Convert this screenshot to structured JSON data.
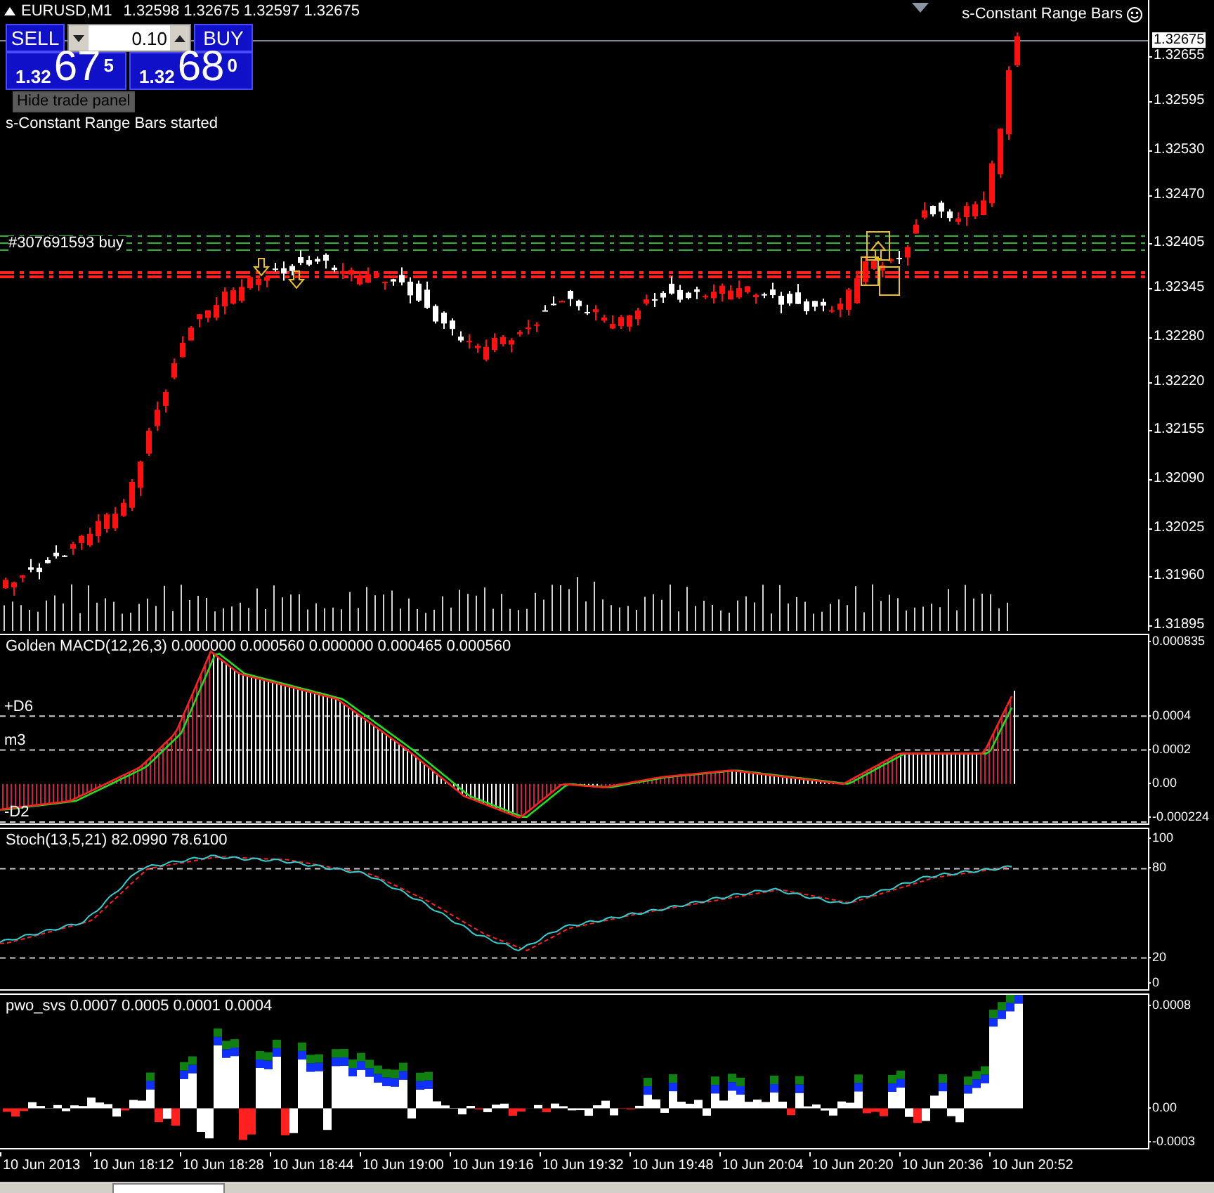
{
  "chart_header": {
    "symbol": "EURUSD,M1",
    "quotes": "1.32598 1.32675 1.32597 1.32675"
  },
  "trade_panel": {
    "sell_label": "SELL",
    "buy_label": "BUY",
    "lot_value": "0.10",
    "tooltip": "Hide trade panel",
    "sell_price": {
      "prefix": "1.32",
      "big": "67",
      "pip": "5"
    },
    "buy_price": {
      "prefix": "1.32",
      "big": "68",
      "pip": "0"
    }
  },
  "status_message": "s-Constant Range Bars started",
  "expert_name": "s-Constant Range Bars",
  "order_lines": [
    {
      "label": "#307691593 buy"
    }
  ],
  "price_axis": {
    "current": "1.32675",
    "ticks": [
      "1.32655",
      "1.32595",
      "1.32530",
      "1.32470",
      "1.32405",
      "1.32345",
      "1.32280",
      "1.32220",
      "1.32155",
      "1.32090",
      "1.32025",
      "1.31960",
      "1.31895"
    ]
  },
  "panes": [
    {
      "kind": "macd",
      "title": "Golden MACD(12,26,3) 0.000000 0.000560 0.000000 0.000465 0.000560",
      "level_labels": [
        "+D6",
        "m3",
        "-D2"
      ],
      "ticks": [
        "0.000835",
        "0.0004",
        "0.0002",
        "0.00",
        "-0.000224"
      ]
    },
    {
      "kind": "stoch",
      "title": "Stoch(13,5,21) 82.0990 78.6100",
      "ticks": [
        "100",
        "80",
        "20",
        "0"
      ]
    },
    {
      "kind": "pwo",
      "title": "pwo_svs 0.0007 0.0005 0.0001 0.0004",
      "ticks": [
        "0.0008",
        "0.00",
        "-0.0003"
      ]
    }
  ],
  "time_axis": [
    "10 Jun 2013",
    "10 Jun 18:12",
    "10 Jun 18:28",
    "10 Jun 18:44",
    "10 Jun 19:00",
    "10 Jun 19:16",
    "10 Jun 19:32",
    "10 Jun 19:48",
    "10 Jun 20:04",
    "10 Jun 20:20",
    "10 Jun 20:36",
    "10 Jun 20:52"
  ]
}
